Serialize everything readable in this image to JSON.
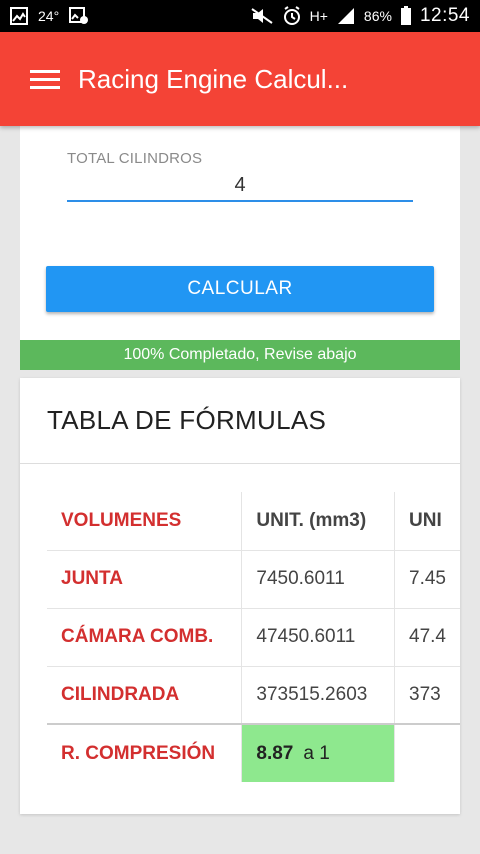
{
  "status_bar": {
    "temperature": "24°",
    "signal_type": "H+",
    "battery": "86%",
    "time": "12:54"
  },
  "app_bar": {
    "title": "Racing Engine Calcul..."
  },
  "form": {
    "total_cilindros_label": "TOTAL CILINDROS",
    "total_cilindros_value": "4",
    "calc_button": "CALCULAR"
  },
  "progress": {
    "percent": 100,
    "text": "100% Completado, Revise abajo",
    "color": "#5cb85c"
  },
  "table": {
    "title": "TABLA DE FÓRMULAS",
    "header": [
      "VOLUMENES",
      "UNIT. (mm3)",
      "UNI"
    ],
    "rows": [
      [
        "JUNTA",
        "7450.6011",
        "7.45"
      ],
      [
        "CÁMARA COMB.",
        "47450.6011",
        "47.4"
      ],
      [
        "CILINDRADA",
        "373515.2603",
        "373"
      ]
    ],
    "compression": {
      "label": "R. COMPRESIÓN",
      "value": "8.87",
      "suffix": "a 1"
    }
  },
  "colors": {
    "app_bar": "#f44336",
    "button": "#2196f3",
    "label_red": "#d32f2f",
    "highlight": "#8ee88e"
  }
}
